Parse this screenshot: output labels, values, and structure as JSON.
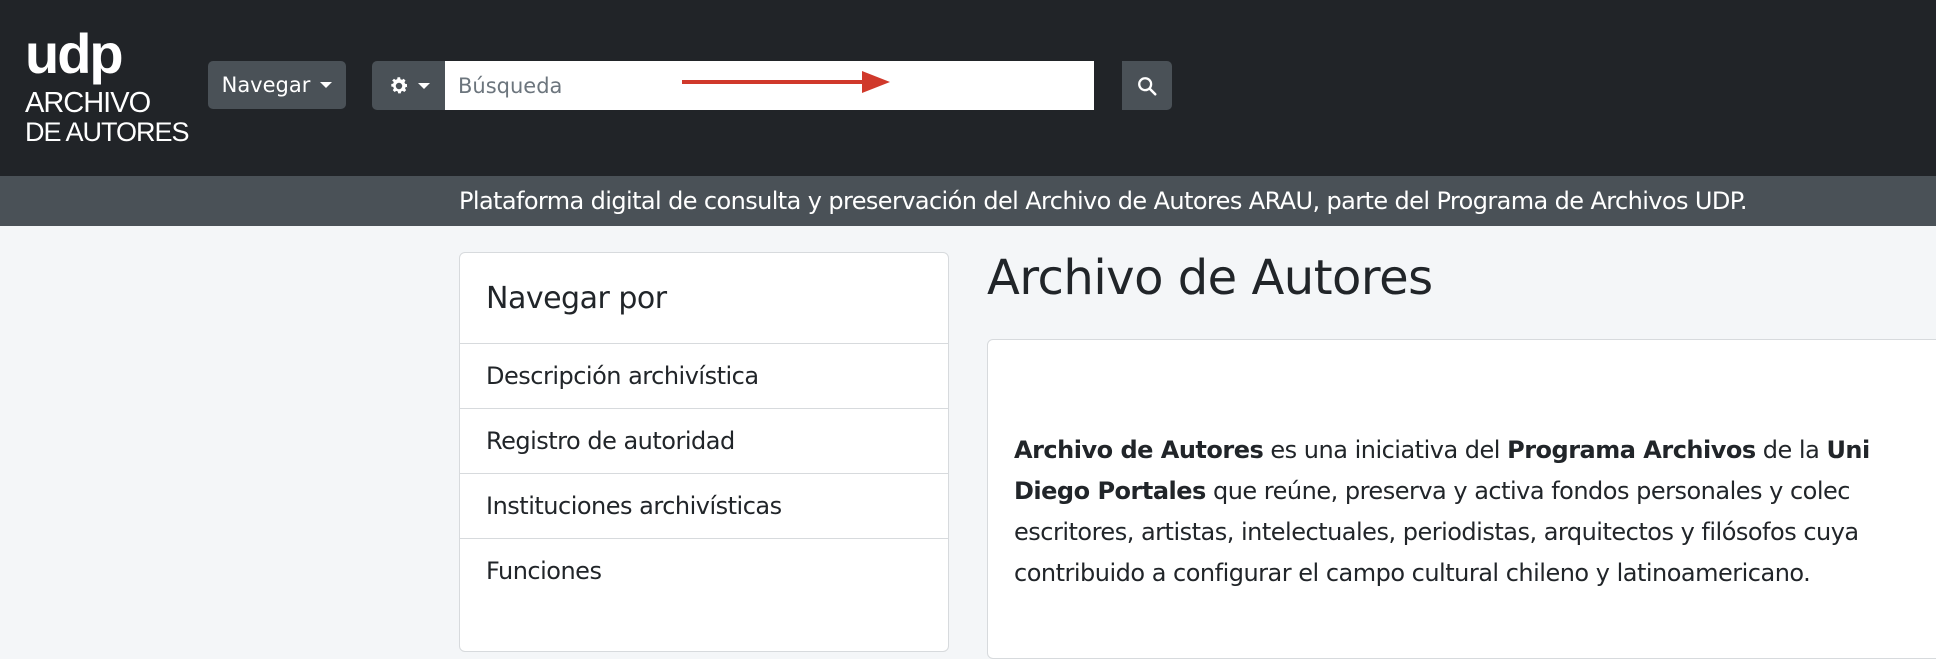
{
  "logo": {
    "mark": "udp",
    "line1": "ARCHIVO",
    "line2": "DE AUTORES"
  },
  "header": {
    "browse_label": "Navegar",
    "search_placeholder": "Búsqueda",
    "search_value": ""
  },
  "tagline": "Plataforma digital de consulta y preservación del Archivo de Autores ARAU, parte del Programa de Archivos UDP.",
  "browse": {
    "title": "Navegar por",
    "items": [
      {
        "label": "Descripción archivística"
      },
      {
        "label": "Registro de autoridad"
      },
      {
        "label": "Instituciones archivísticas"
      },
      {
        "label": "Funciones"
      }
    ]
  },
  "main": {
    "title": "Archivo de Autores",
    "intro": {
      "l1_b1": "Archivo de Autores",
      "l1_t1": " es una iniciativa del ",
      "l1_b2": "Programa Archivos",
      "l1_t2": " de la ",
      "l1_b3": "Uni",
      "l2_b1": "Diego Portales",
      "l2_t1": " que reúne, preserva y activa fondos personales y colec",
      "l3": "escritores, artistas, intelectuales, periodistas, arquitectos y filósofos cuya",
      "l4": "contribuido a configurar el campo cultural chileno y latinoamericano."
    }
  },
  "colors": {
    "header_bg": "#212428",
    "bar_bg": "#4a5157",
    "arrow": "#d0392b",
    "page_bg": "#f4f6f8"
  },
  "icons": {
    "options": "gear-icon",
    "search": "search-icon",
    "caret": "caret-down-icon",
    "annotation": "arrow-right-icon"
  }
}
